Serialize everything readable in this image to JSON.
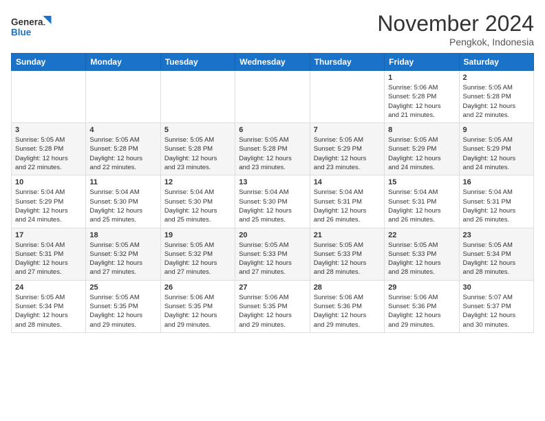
{
  "header": {
    "logo_line1": "General",
    "logo_line2": "Blue",
    "month": "November 2024",
    "location": "Pengkok, Indonesia"
  },
  "weekdays": [
    "Sunday",
    "Monday",
    "Tuesday",
    "Wednesday",
    "Thursday",
    "Friday",
    "Saturday"
  ],
  "weeks": [
    [
      {
        "day": "",
        "info": ""
      },
      {
        "day": "",
        "info": ""
      },
      {
        "day": "",
        "info": ""
      },
      {
        "day": "",
        "info": ""
      },
      {
        "day": "",
        "info": ""
      },
      {
        "day": "1",
        "info": "Sunrise: 5:06 AM\nSunset: 5:28 PM\nDaylight: 12 hours\nand 21 minutes."
      },
      {
        "day": "2",
        "info": "Sunrise: 5:05 AM\nSunset: 5:28 PM\nDaylight: 12 hours\nand 22 minutes."
      }
    ],
    [
      {
        "day": "3",
        "info": "Sunrise: 5:05 AM\nSunset: 5:28 PM\nDaylight: 12 hours\nand 22 minutes."
      },
      {
        "day": "4",
        "info": "Sunrise: 5:05 AM\nSunset: 5:28 PM\nDaylight: 12 hours\nand 22 minutes."
      },
      {
        "day": "5",
        "info": "Sunrise: 5:05 AM\nSunset: 5:28 PM\nDaylight: 12 hours\nand 23 minutes."
      },
      {
        "day": "6",
        "info": "Sunrise: 5:05 AM\nSunset: 5:28 PM\nDaylight: 12 hours\nand 23 minutes."
      },
      {
        "day": "7",
        "info": "Sunrise: 5:05 AM\nSunset: 5:29 PM\nDaylight: 12 hours\nand 23 minutes."
      },
      {
        "day": "8",
        "info": "Sunrise: 5:05 AM\nSunset: 5:29 PM\nDaylight: 12 hours\nand 24 minutes."
      },
      {
        "day": "9",
        "info": "Sunrise: 5:05 AM\nSunset: 5:29 PM\nDaylight: 12 hours\nand 24 minutes."
      }
    ],
    [
      {
        "day": "10",
        "info": "Sunrise: 5:04 AM\nSunset: 5:29 PM\nDaylight: 12 hours\nand 24 minutes."
      },
      {
        "day": "11",
        "info": "Sunrise: 5:04 AM\nSunset: 5:30 PM\nDaylight: 12 hours\nand 25 minutes."
      },
      {
        "day": "12",
        "info": "Sunrise: 5:04 AM\nSunset: 5:30 PM\nDaylight: 12 hours\nand 25 minutes."
      },
      {
        "day": "13",
        "info": "Sunrise: 5:04 AM\nSunset: 5:30 PM\nDaylight: 12 hours\nand 25 minutes."
      },
      {
        "day": "14",
        "info": "Sunrise: 5:04 AM\nSunset: 5:31 PM\nDaylight: 12 hours\nand 26 minutes."
      },
      {
        "day": "15",
        "info": "Sunrise: 5:04 AM\nSunset: 5:31 PM\nDaylight: 12 hours\nand 26 minutes."
      },
      {
        "day": "16",
        "info": "Sunrise: 5:04 AM\nSunset: 5:31 PM\nDaylight: 12 hours\nand 26 minutes."
      }
    ],
    [
      {
        "day": "17",
        "info": "Sunrise: 5:04 AM\nSunset: 5:31 PM\nDaylight: 12 hours\nand 27 minutes."
      },
      {
        "day": "18",
        "info": "Sunrise: 5:05 AM\nSunset: 5:32 PM\nDaylight: 12 hours\nand 27 minutes."
      },
      {
        "day": "19",
        "info": "Sunrise: 5:05 AM\nSunset: 5:32 PM\nDaylight: 12 hours\nand 27 minutes."
      },
      {
        "day": "20",
        "info": "Sunrise: 5:05 AM\nSunset: 5:33 PM\nDaylight: 12 hours\nand 27 minutes."
      },
      {
        "day": "21",
        "info": "Sunrise: 5:05 AM\nSunset: 5:33 PM\nDaylight: 12 hours\nand 28 minutes."
      },
      {
        "day": "22",
        "info": "Sunrise: 5:05 AM\nSunset: 5:33 PM\nDaylight: 12 hours\nand 28 minutes."
      },
      {
        "day": "23",
        "info": "Sunrise: 5:05 AM\nSunset: 5:34 PM\nDaylight: 12 hours\nand 28 minutes."
      }
    ],
    [
      {
        "day": "24",
        "info": "Sunrise: 5:05 AM\nSunset: 5:34 PM\nDaylight: 12 hours\nand 28 minutes."
      },
      {
        "day": "25",
        "info": "Sunrise: 5:05 AM\nSunset: 5:35 PM\nDaylight: 12 hours\nand 29 minutes."
      },
      {
        "day": "26",
        "info": "Sunrise: 5:06 AM\nSunset: 5:35 PM\nDaylight: 12 hours\nand 29 minutes."
      },
      {
        "day": "27",
        "info": "Sunrise: 5:06 AM\nSunset: 5:35 PM\nDaylight: 12 hours\nand 29 minutes."
      },
      {
        "day": "28",
        "info": "Sunrise: 5:06 AM\nSunset: 5:36 PM\nDaylight: 12 hours\nand 29 minutes."
      },
      {
        "day": "29",
        "info": "Sunrise: 5:06 AM\nSunset: 5:36 PM\nDaylight: 12 hours\nand 29 minutes."
      },
      {
        "day": "30",
        "info": "Sunrise: 5:07 AM\nSunset: 5:37 PM\nDaylight: 12 hours\nand 30 minutes."
      }
    ]
  ]
}
